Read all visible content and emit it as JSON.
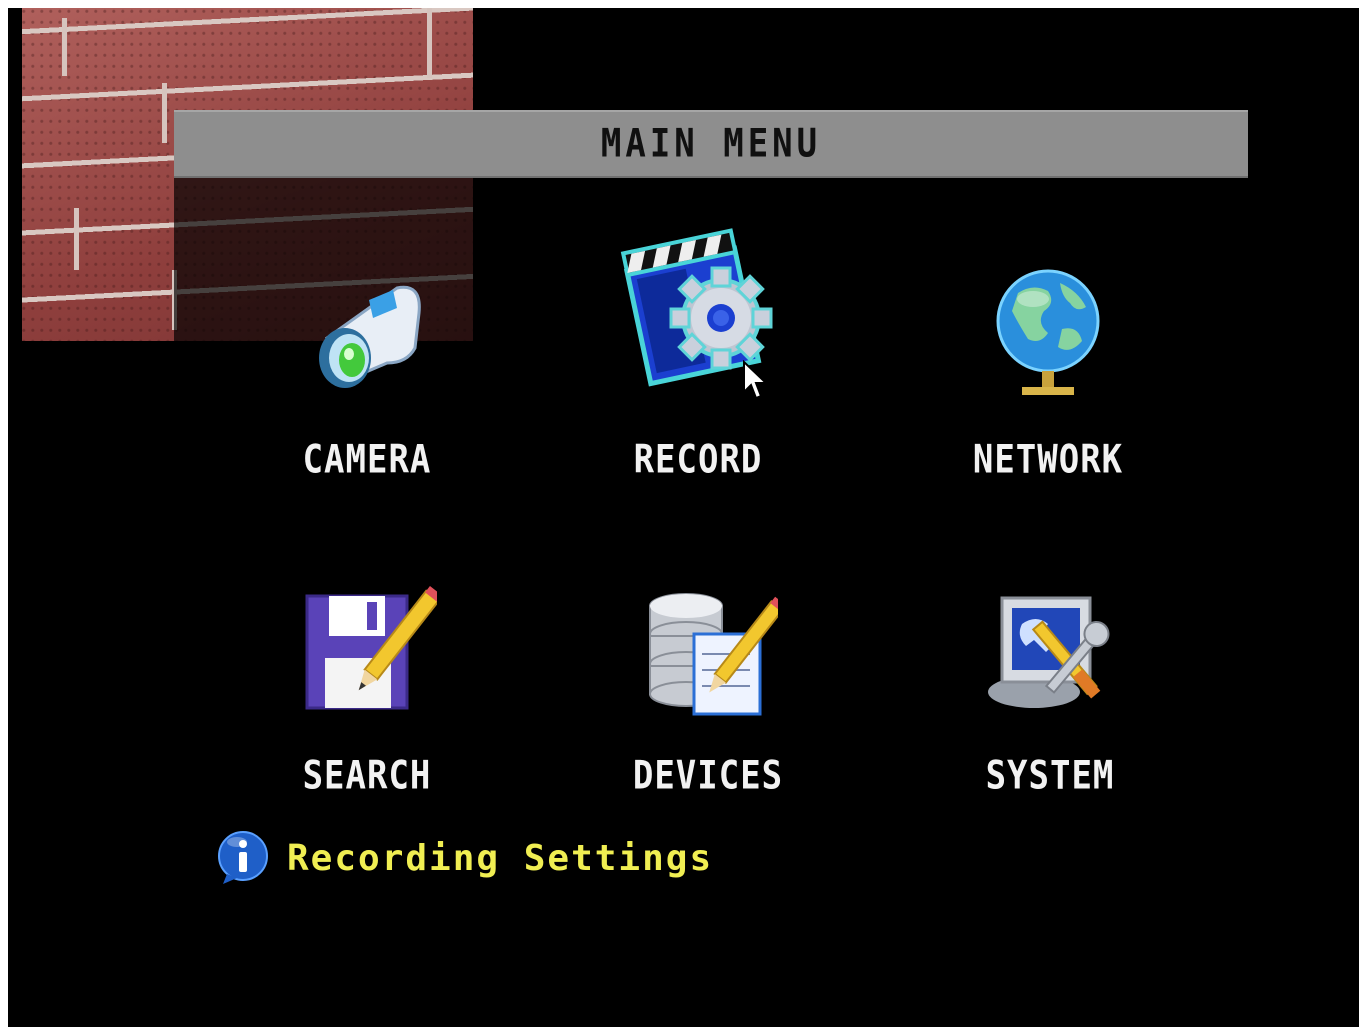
{
  "window": {
    "title": "MAIN MENU"
  },
  "menu": {
    "items": [
      {
        "label": "CAMERA",
        "icon": "camera-icon"
      },
      {
        "label": "RECORD",
        "icon": "record-icon",
        "selected": true
      },
      {
        "label": "NETWORK",
        "icon": "network-globe-icon"
      },
      {
        "label": "SEARCH",
        "icon": "search-floppy-icon"
      },
      {
        "label": "DEVICES",
        "icon": "devices-database-icon"
      },
      {
        "label": "SYSTEM",
        "icon": "system-tools-icon"
      }
    ]
  },
  "info": {
    "icon": "info-icon",
    "text": "Recording Settings"
  },
  "colors": {
    "background": "#000000",
    "titlebar": "#8e8e8e",
    "label": "#f2f2f2",
    "info_text": "#f0ee52"
  }
}
